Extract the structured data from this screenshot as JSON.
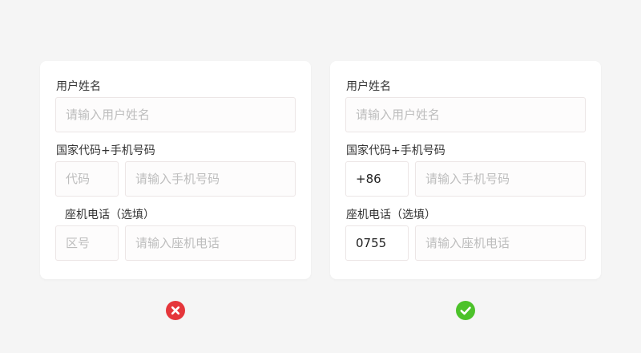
{
  "bad_example": {
    "name_label": "用户姓名",
    "name_placeholder": "请输入用户姓名",
    "phone_label": "国家代码+手机号码",
    "code_placeholder": "代码",
    "mobile_placeholder": "请输入手机号码",
    "landline_label": "座机电话（选填）",
    "area_placeholder": "区号",
    "landline_placeholder": "请输入座机电话"
  },
  "good_example": {
    "name_label": "用户姓名",
    "name_placeholder": "请输入用户姓名",
    "phone_label": "国家代码+手机号码",
    "code_value": "+86",
    "mobile_placeholder": "请输入手机号码",
    "landline_label": "座机电话（选填）",
    "area_value": "0755",
    "landline_placeholder": "请输入座机电话"
  },
  "indicators": {
    "bad": {
      "icon": "close-icon",
      "color": "#e5363b"
    },
    "good": {
      "icon": "check-icon",
      "color": "#4cc22a"
    }
  }
}
